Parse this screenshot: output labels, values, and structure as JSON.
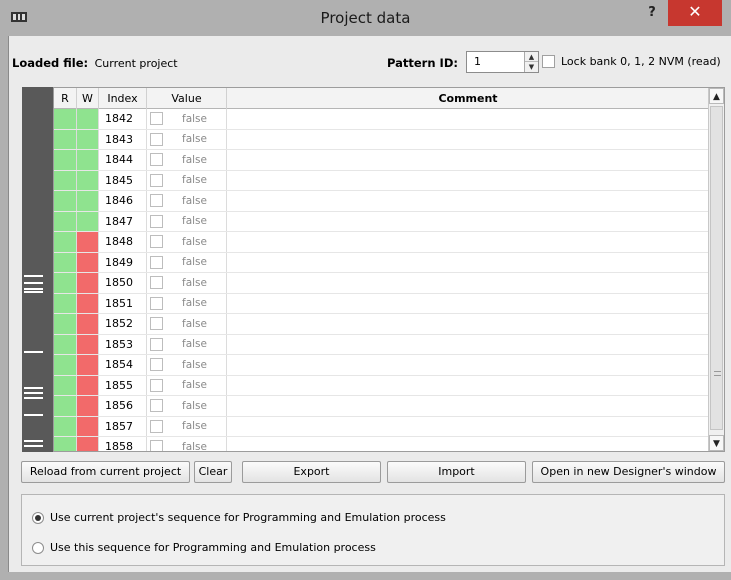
{
  "window": {
    "title": "Project data",
    "help_label": "?",
    "close_glyph": "✕",
    "app_icon": "app-window-icon"
  },
  "header": {
    "loaded_file_label": "Loaded file:",
    "loaded_file_value": "Current project",
    "pattern_id_label": "Pattern ID:",
    "pattern_id_value": "1",
    "lock_label": "Lock bank 0, 1, 2 NVM (read)"
  },
  "table": {
    "columns": [
      "R",
      "W",
      "Index",
      "Value",
      "Comment"
    ],
    "rows": [
      {
        "r": "green",
        "w": "green",
        "index": "1842",
        "value": "false",
        "comment": ""
      },
      {
        "r": "green",
        "w": "green",
        "index": "1843",
        "value": "false",
        "comment": ""
      },
      {
        "r": "green",
        "w": "green",
        "index": "1844",
        "value": "false",
        "comment": ""
      },
      {
        "r": "green",
        "w": "green",
        "index": "1845",
        "value": "false",
        "comment": ""
      },
      {
        "r": "green",
        "w": "green",
        "index": "1846",
        "value": "false",
        "comment": ""
      },
      {
        "r": "green",
        "w": "green",
        "index": "1847",
        "value": "false",
        "comment": ""
      },
      {
        "r": "green",
        "w": "red",
        "index": "1848",
        "value": "false",
        "comment": ""
      },
      {
        "r": "green",
        "w": "red",
        "index": "1849",
        "value": "false",
        "comment": ""
      },
      {
        "r": "green",
        "w": "red",
        "index": "1850",
        "value": "false",
        "comment": ""
      },
      {
        "r": "green",
        "w": "red",
        "index": "1851",
        "value": "false",
        "comment": ""
      },
      {
        "r": "green",
        "w": "red",
        "index": "1852",
        "value": "false",
        "comment": ""
      },
      {
        "r": "green",
        "w": "red",
        "index": "1853",
        "value": "false",
        "comment": ""
      },
      {
        "r": "green",
        "w": "red",
        "index": "1854",
        "value": "false",
        "comment": ""
      },
      {
        "r": "green",
        "w": "red",
        "index": "1855",
        "value": "false",
        "comment": ""
      },
      {
        "r": "green",
        "w": "red",
        "index": "1856",
        "value": "false",
        "comment": ""
      },
      {
        "r": "green",
        "w": "red",
        "index": "1857",
        "value": "false",
        "comment": ""
      },
      {
        "r": "green",
        "w": "red",
        "index": "1858",
        "value": "false",
        "comment": ""
      }
    ]
  },
  "buttons": {
    "reload": "Reload from current project",
    "clear": "Clear",
    "export": "Export",
    "import": "Import",
    "open_new": "Open in new Designer's window"
  },
  "sequence_options": [
    {
      "label": "Use current project's sequence for Programming and Emulation process",
      "selected": true
    },
    {
      "label": "Use this sequence for Programming and Emulation process",
      "selected": false
    }
  ],
  "colors": {
    "read_ok": "#8fe38f",
    "write_locked": "#f26a6a",
    "close_button": "#c7372f"
  }
}
